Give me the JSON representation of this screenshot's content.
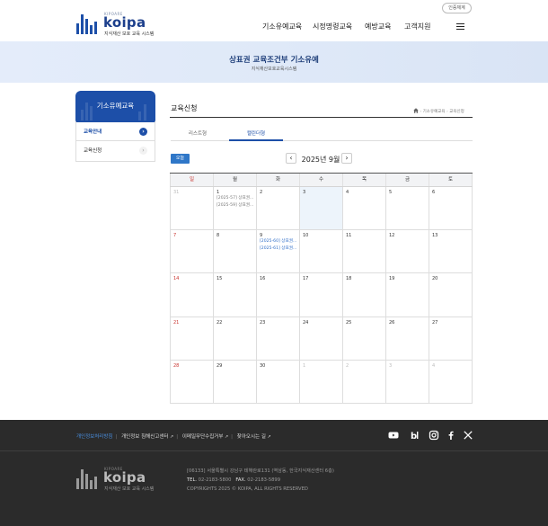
{
  "header": {
    "logo_small": "KIPOARE",
    "logo_word": "koipa",
    "logo_tagline": "지식재산 보호 교육 시스템",
    "cert_button": "인증체계",
    "nav": [
      "기소유예교육",
      "시정명령교육",
      "예방교육",
      "고객지원"
    ]
  },
  "banner": {
    "title": "상표권 교육조건부 기소유예",
    "subtitle": "지식재산보호교육시스템"
  },
  "side": {
    "title": "기소유예교육",
    "items": [
      {
        "label": "교육안내",
        "active": true
      },
      {
        "label": "교육신청",
        "active": false
      }
    ]
  },
  "content": {
    "title": "교육신청",
    "breadcrumb": [
      "기소유예교육",
      "교육신청"
    ]
  },
  "tabs": [
    {
      "label": "리스트형",
      "active": false
    },
    {
      "label": "캘린더형",
      "active": true
    }
  ],
  "calendar": {
    "today_label": "오늘",
    "prev": "‹",
    "next": "›",
    "month": "2025년 9월",
    "weekdays": [
      "일",
      "월",
      "화",
      "수",
      "목",
      "금",
      "토"
    ],
    "weeks": [
      [
        {
          "d": "31",
          "other": true
        },
        {
          "d": "1",
          "events": [
            {
              "t": "[2025-57] 상표권...",
              "c": "gray"
            },
            {
              "t": "[2025-59] 상표권...",
              "c": "gray"
            }
          ]
        },
        {
          "d": "2"
        },
        {
          "d": "3",
          "today": true
        },
        {
          "d": "4"
        },
        {
          "d": "5"
        },
        {
          "d": "6"
        }
      ],
      [
        {
          "d": "7"
        },
        {
          "d": "8"
        },
        {
          "d": "9",
          "events": [
            {
              "t": "[2025-60] 상표권...",
              "c": "blue"
            },
            {
              "t": "[2025-61] 상표권...",
              "c": "blue"
            }
          ]
        },
        {
          "d": "10"
        },
        {
          "d": "11"
        },
        {
          "d": "12"
        },
        {
          "d": "13"
        }
      ],
      [
        {
          "d": "14"
        },
        {
          "d": "15"
        },
        {
          "d": "16"
        },
        {
          "d": "17"
        },
        {
          "d": "18"
        },
        {
          "d": "19"
        },
        {
          "d": "20"
        }
      ],
      [
        {
          "d": "21"
        },
        {
          "d": "22"
        },
        {
          "d": "23"
        },
        {
          "d": "24"
        },
        {
          "d": "25"
        },
        {
          "d": "26"
        },
        {
          "d": "27"
        }
      ],
      [
        {
          "d": "28"
        },
        {
          "d": "29"
        },
        {
          "d": "30"
        },
        {
          "d": "1",
          "other": true
        },
        {
          "d": "2",
          "other": true
        },
        {
          "d": "3",
          "other": true
        },
        {
          "d": "4",
          "other": true
        }
      ]
    ]
  },
  "footer": {
    "links": [
      {
        "label": "개인정보처리방침",
        "highlight": true
      },
      {
        "label": "개인정보 침해신고센터",
        "highlight": false
      },
      {
        "label": "이메일무단수집거부",
        "highlight": false
      },
      {
        "label": "찾아오시는 길",
        "highlight": false
      }
    ],
    "sns": [
      "youtube-icon",
      "blog-icon",
      "instagram-icon",
      "facebook-icon",
      "x-icon"
    ],
    "address": "[06133] 서울특별시 강남구 테헤란로131 (역삼동, 한국지식재산센터 6층)",
    "tel_label": "TEL.",
    "tel": "02-2183-5800",
    "fax_label": "FAX.",
    "fax": "02-2183-5899",
    "copyright": "COPYRIGHTS 2025 © KOIPA, ALL RIGHTS RESERVED"
  },
  "colors": {
    "primary": "#1d4fa8",
    "accent_button": "#2f77c8",
    "sunday": "#c8322d",
    "event_blue": "#2e6dc8",
    "footer_bg": "#2b2b2b"
  }
}
